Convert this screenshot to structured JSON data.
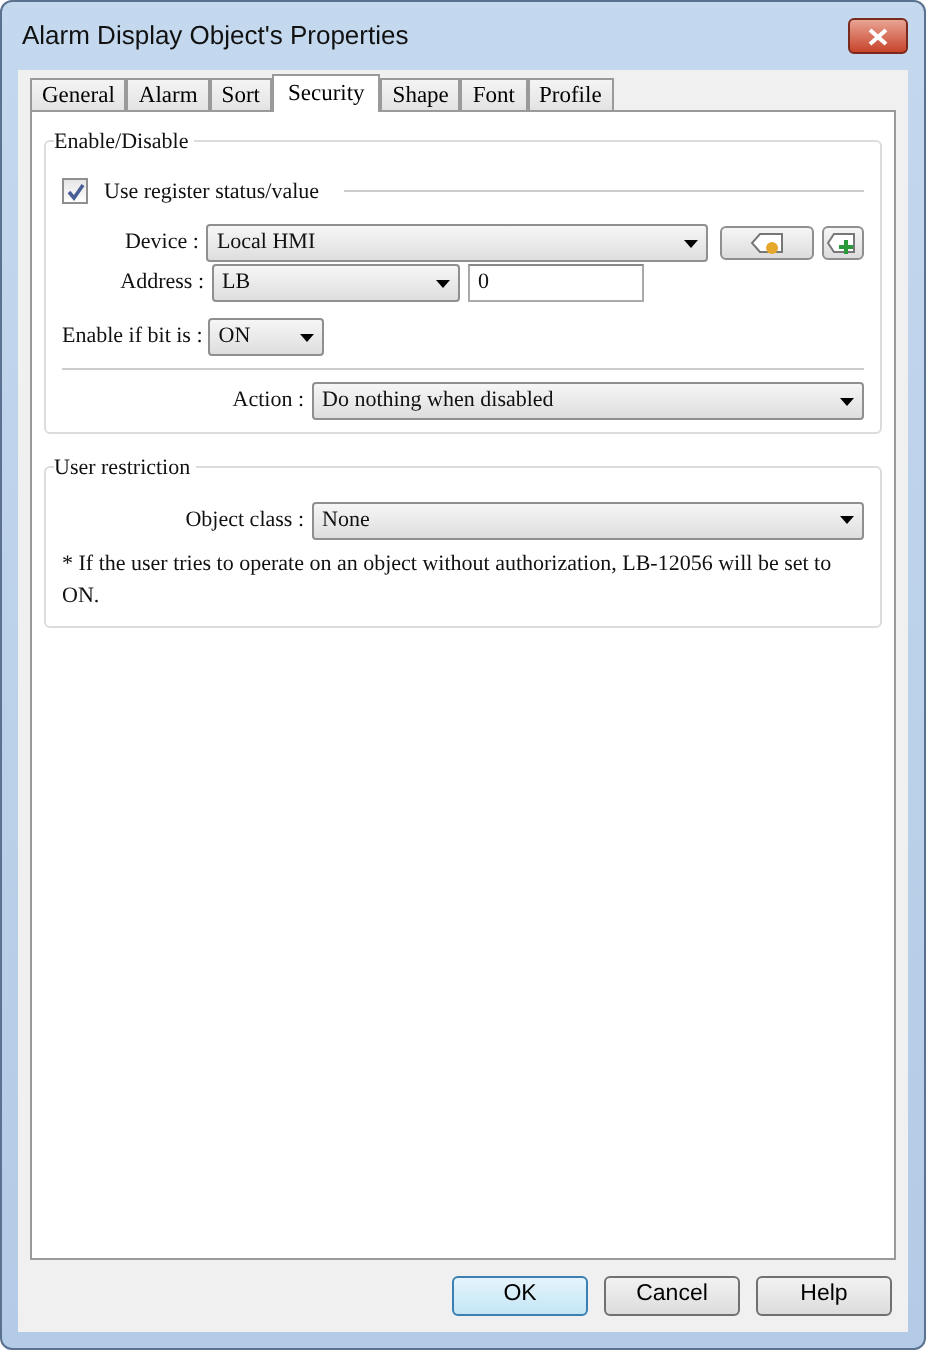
{
  "window": {
    "title": "Alarm Display Object's Properties"
  },
  "tabs": [
    {
      "label": "General",
      "selected": false
    },
    {
      "label": "Alarm",
      "selected": false
    },
    {
      "label": "Sort",
      "selected": false
    },
    {
      "label": "Security",
      "selected": true
    },
    {
      "label": "Shape",
      "selected": false
    },
    {
      "label": "Font",
      "selected": false
    },
    {
      "label": "Profile",
      "selected": false
    }
  ],
  "enable_disable": {
    "title": "Enable/Disable",
    "use_register": {
      "label": "Use register status/value",
      "checked": true
    },
    "device": {
      "label": "Device :",
      "value": "Local HMI"
    },
    "address": {
      "label": "Address :",
      "type": "LB",
      "value": "0"
    },
    "enable_if": {
      "label": "Enable if bit is :",
      "value": "ON"
    },
    "action": {
      "label": "Action :",
      "value": "Do nothing when disabled"
    }
  },
  "user_restriction": {
    "title": "User restriction",
    "object_class": {
      "label": "Object class :",
      "value": "None"
    },
    "note": "* If the user tries to operate on an object without authorization, LB-12056 will be set to ON."
  },
  "buttons": [
    {
      "label": "OK",
      "default": true
    },
    {
      "label": "Cancel",
      "default": false
    },
    {
      "label": "Help",
      "default": false
    }
  ]
}
